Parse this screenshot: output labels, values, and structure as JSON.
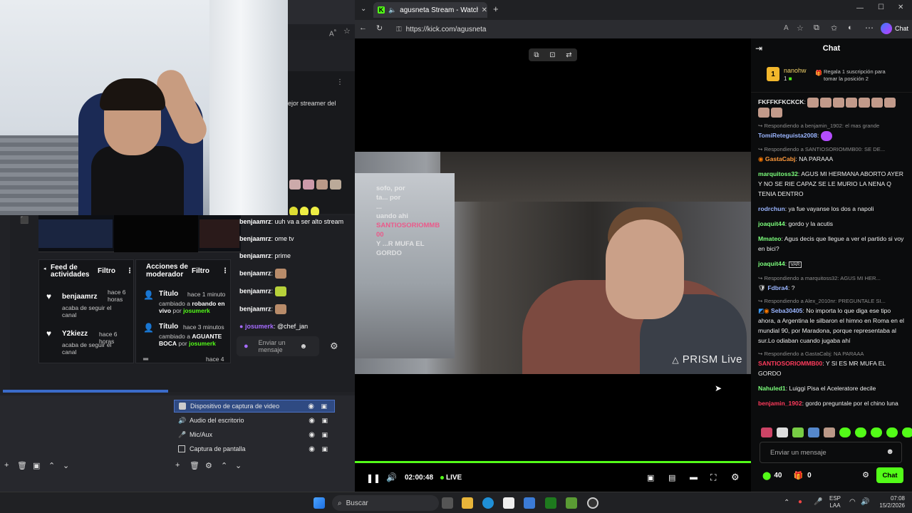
{
  "obs": {
    "feed": {
      "title": "Feed de actividades",
      "filter": "Filtro",
      "items": [
        {
          "user": "benjaamrz",
          "time": "hace 6 horas",
          "action": "acaba de seguir el canal"
        },
        {
          "user": "Y2kiezz",
          "time": "hace 6 horas",
          "action": "acaba de seguir el canal"
        }
      ]
    },
    "mod": {
      "title": "Acciones de moderador",
      "filter": "Filtro",
      "items": [
        {
          "label": "Título",
          "time": "hace 1 minuto",
          "pre": "cambiado a",
          "value": "robando en vivo",
          "by": "por",
          "mod": "josumerk"
        },
        {
          "label": "Título",
          "time": "hace 3 minutos",
          "pre": "cambiado a",
          "value": "AGUANTE BOCA",
          "by": "por",
          "mod": "josumerk"
        },
        {
          "label": "",
          "time": "hace 4",
          "pre": "",
          "value": "",
          "by": "",
          "mod": ""
        }
      ]
    },
    "chat": {
      "messages": [
        {
          "user": "benjaamrz",
          "text": "uuh va a ser alto stream"
        },
        {
          "user": "benjaamrz",
          "text": "ome tv"
        },
        {
          "user": "benjaamrz",
          "text": "prime"
        },
        {
          "user": "benjaamrz",
          "text": ""
        },
        {
          "user": "benjaamrz",
          "text": ""
        },
        {
          "user": "benjaamrz",
          "text": ""
        },
        {
          "user": "josumerk",
          "text": "@chef_jan"
        }
      ],
      "input_placeholder": "Enviar un mensaje",
      "partial_text": "ejor streamer del"
    },
    "sources": [
      {
        "name": "Dispositivo de captura de video",
        "selected": true
      },
      {
        "name": "Audio del escritorio",
        "selected": false
      },
      {
        "name": "Mic/Aux",
        "selected": false
      },
      {
        "name": "Captura de pantalla",
        "selected": false
      }
    ]
  },
  "browser": {
    "tab_title": "agusneta Stream - Watch Live",
    "url": "https://kick.com/agusneta",
    "chat_button": "Chat"
  },
  "player": {
    "time": "02:00:48",
    "live_label": "LIVE",
    "watermark": "PRISM Live",
    "overlay_lines": [
      "sofo, por",
      "ta... por",
      "...",
      "uando ahi",
      "SANTIOSORIOMMB",
      "00",
      "Y ...R MUFA EL",
      "GORDO"
    ]
  },
  "chat": {
    "title": "Chat",
    "pinned": {
      "rank": "1",
      "user": "nanohw",
      "count": "1",
      "note": "Regala 1 suscripción para tomar la posición 2"
    },
    "messages": [
      {
        "reply": "",
        "user": "FKFFKFKCKCK",
        "color": "#ffffff",
        "text": ""
      },
      {
        "reply": "Respondiendo a benjamin_1902: el mas grande",
        "user": "TomiReteguista2008",
        "color": "#9ab5ff",
        "text": ""
      },
      {
        "reply": "Respondiendo a SANTIOSORIOMMB00: SE DE...",
        "user": "GastaCabj",
        "color": "#ff9a3c",
        "text": "NA PARAAA"
      },
      {
        "reply": "",
        "user": "marquitoss32",
        "color": "#7cff7c",
        "text": "AGUS MI HERMANA ABORTO AYER Y NO SE RIE CAPAZ SE LE MURIO LA NENA Q TENIA DENTRO"
      },
      {
        "reply": "",
        "user": "rodrchun",
        "color": "#9ab5ff",
        "text": "ya fue vayanse los dos a napoli"
      },
      {
        "reply": "",
        "user": "joaquit44",
        "color": "#7cff7c",
        "text": "gordo y la acutis"
      },
      {
        "reply": "",
        "user": "Mmateo",
        "color": "#7cff7c",
        "text": "Agus decis que llegue a ver el partido si voy en bici?"
      },
      {
        "reply": "",
        "user": "joaquit44",
        "color": "#7cff7c",
        "text": "VAR"
      },
      {
        "reply": "Respondiendo a marquitoss32: AGUS MI HER...",
        "user": "Fdbra4",
        "color": "#9ab5ff",
        "text": "?"
      },
      {
        "reply": "Respondiendo a Alex_2010nr: PREGUNTALE SI...",
        "user": "Seba30405",
        "color": "#9ab5ff",
        "text": "No importa lo que diga ese tipo ahora, a Argentina le silbaron el himno en Roma en el mundial 90, por Maradona, porque representaba al sur.Lo odiaban cuando jugaba ahí"
      },
      {
        "reply": "Respondiendo a GastaCabj: NA PARAAA",
        "user": "SANTIOSORIOMMB00",
        "color": "#ff3b5c",
        "text": "Y SI ES MR MUFA EL GORDO"
      },
      {
        "reply": "",
        "user": "Nahuled1",
        "color": "#7cff7c",
        "text": "Luiggi Pisa el Aceleratore decile"
      },
      {
        "reply": "",
        "user": "benjamin_1902",
        "color": "#ff3b5c",
        "text": "gordo preguntale por el chino luna"
      }
    ],
    "input_placeholder": "Enviar un mensaje",
    "points": "40",
    "gifts": "0",
    "send_label": "Chat"
  },
  "taskbar": {
    "search": "Buscar",
    "lang": "ESP",
    "lang2": "LAA",
    "time": "07:08",
    "date": "15/2/2026"
  },
  "colors": {
    "kick_green": "#53fc18",
    "chat_bg": "#0b0c0d"
  }
}
